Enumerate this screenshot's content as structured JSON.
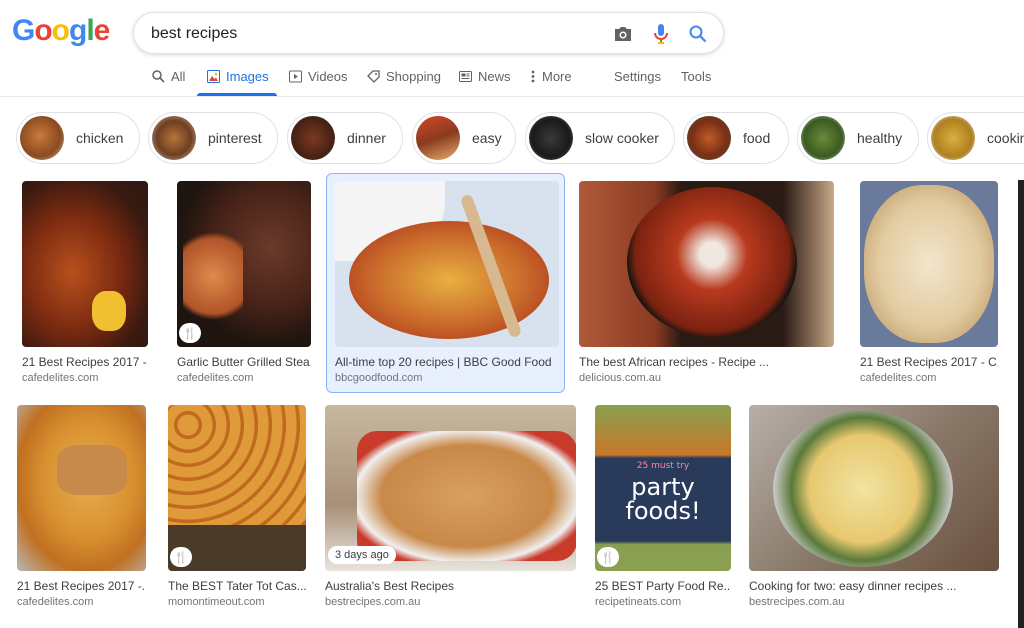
{
  "logo": {
    "letters": [
      "G",
      "o",
      "o",
      "g",
      "l",
      "e"
    ]
  },
  "search": {
    "query": "best recipes"
  },
  "icons": {
    "camera": "camera-icon",
    "mic": "mic-icon",
    "search": "search-icon"
  },
  "tabs": [
    {
      "label": "All",
      "icon": "search-icon"
    },
    {
      "label": "Images",
      "icon": "image-icon",
      "active": true
    },
    {
      "label": "Videos",
      "icon": "play-icon"
    },
    {
      "label": "Shopping",
      "icon": "tag-icon"
    },
    {
      "label": "News",
      "icon": "newspaper-icon"
    },
    {
      "label": "More",
      "icon": "kebab-icon"
    },
    {
      "label": "Settings"
    },
    {
      "label": "Tools"
    }
  ],
  "chips": [
    "chicken",
    "pinterest",
    "dinner",
    "easy",
    "slow cooker",
    "food",
    "healthy",
    "cooking"
  ],
  "row1": [
    {
      "title": "21 Best Recipes 2017 - ...",
      "domain": "cafedelites.com"
    },
    {
      "title": "Garlic Butter Grilled Stea...",
      "domain": "cafedelites.com",
      "badge": "🍴"
    },
    {
      "title": "All-time top 20 recipes | BBC Good Food",
      "domain": "bbcgoodfood.com"
    },
    {
      "title": "The best African recipes - Recipe ...",
      "domain": "delicious.com.au"
    },
    {
      "title": "21 Best Recipes 2017 - C...",
      "domain": "cafedelites.com"
    }
  ],
  "row2": [
    {
      "title": "21 Best Recipes 2017 -...",
      "domain": "cafedelites.com"
    },
    {
      "title": "The BEST Tater Tot Cas...",
      "domain": "momontimeout.com",
      "badge": "🍴"
    },
    {
      "title": "Australia's Best Recipes",
      "domain": "bestrecipes.com.au",
      "age": "3 days ago"
    },
    {
      "title": "25 BEST Party Food Re...",
      "domain": "recipetineats.com",
      "badge": "🍴",
      "overlay": {
        "small": "25 must try",
        "big1": "party",
        "big2": "foods!"
      }
    },
    {
      "title": "Cooking for two: easy dinner recipes ...",
      "domain": "bestrecipes.com.au"
    }
  ],
  "colors": {
    "accent": "#1a73e8",
    "text": "#202124",
    "muted": "#70757a"
  }
}
